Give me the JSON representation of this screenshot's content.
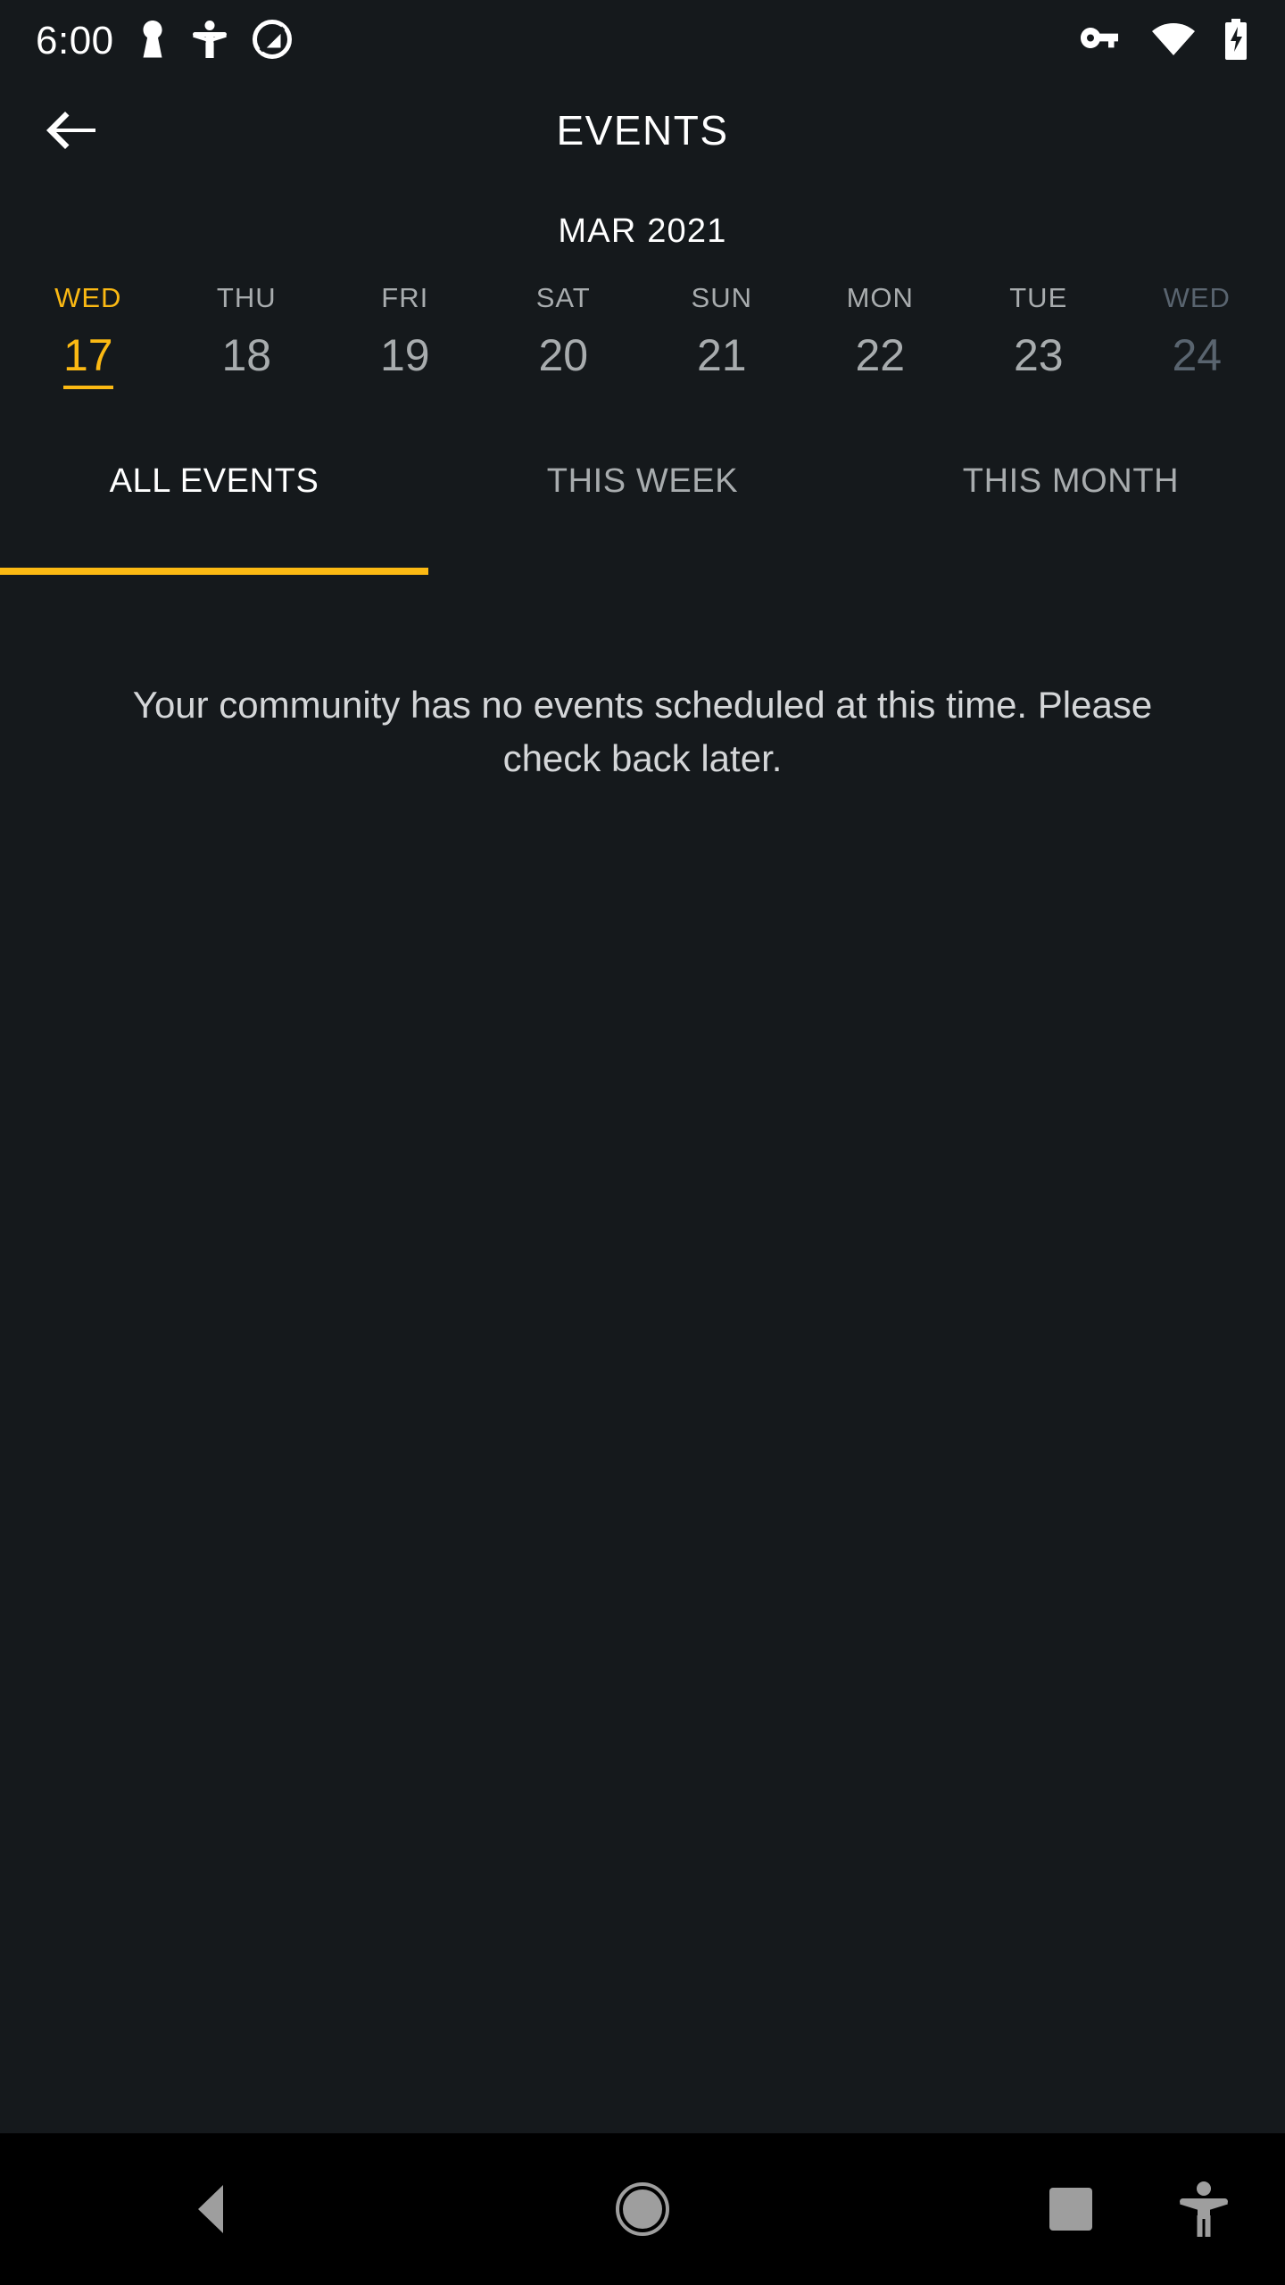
{
  "status_bar": {
    "clock": "6:00",
    "left_icons": [
      {
        "name": "work-profile-keyhole-icon"
      },
      {
        "name": "accessibility-icon"
      },
      {
        "name": "do-not-disturb-icon"
      }
    ],
    "right_icons": [
      {
        "name": "vpn-key-icon"
      },
      {
        "name": "wifi-icon"
      },
      {
        "name": "battery-charging-icon"
      }
    ]
  },
  "app_bar": {
    "back_label": "",
    "title": "EVENTS"
  },
  "calendar": {
    "month_label": "MAR 2021",
    "days": [
      {
        "dow": "WED",
        "num": "17",
        "state": "selected"
      },
      {
        "dow": "THU",
        "num": "18",
        "state": "normal"
      },
      {
        "dow": "FRI",
        "num": "19",
        "state": "normal"
      },
      {
        "dow": "SAT",
        "num": "20",
        "state": "normal"
      },
      {
        "dow": "SUN",
        "num": "21",
        "state": "normal"
      },
      {
        "dow": "MON",
        "num": "22",
        "state": "normal"
      },
      {
        "dow": "TUE",
        "num": "23",
        "state": "normal"
      },
      {
        "dow": "WED",
        "num": "24",
        "state": "dimmed"
      }
    ]
  },
  "tabs": [
    {
      "label": "ALL EVENTS",
      "active": true
    },
    {
      "label": "THIS WEEK",
      "active": false
    },
    {
      "label": "THIS MONTH",
      "active": false
    }
  ],
  "content": {
    "empty_message": "Your community has no events scheduled at this time. Please check back later."
  },
  "nav_bar": {
    "buttons": [
      {
        "name": "nav-back-button"
      },
      {
        "name": "nav-home-button"
      },
      {
        "name": "nav-recents-button"
      }
    ],
    "accessibility_button": {
      "name": "nav-accessibility-button"
    }
  },
  "colors": {
    "accent": "#fbb913",
    "background": "#15191c",
    "nav_background": "#000000",
    "text_primary": "#ffffff",
    "text_secondary": "#a8acae",
    "text_dimmed": "#59646f"
  }
}
